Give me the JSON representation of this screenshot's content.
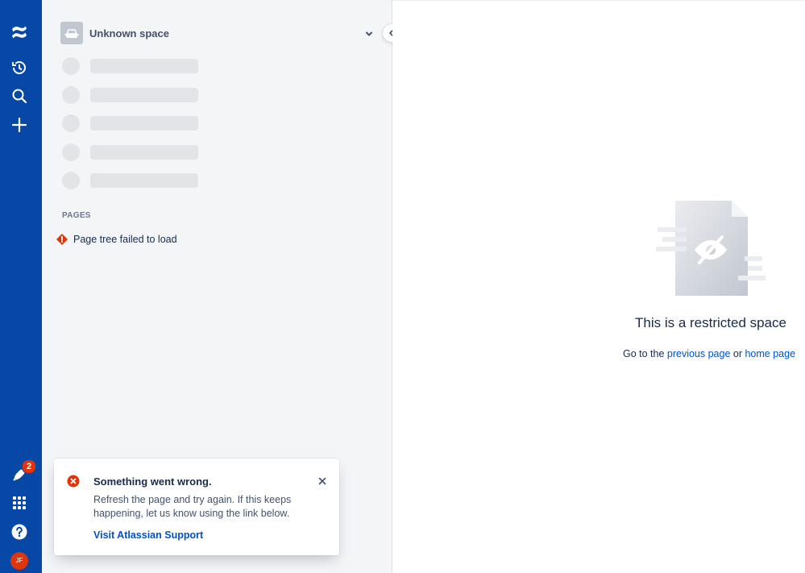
{
  "global_nav": {
    "notification_count": "2",
    "avatar_initials": "JF",
    "colors": {
      "background": "#0747A6",
      "badge": "#DE350B"
    },
    "icons": [
      "confluence-logo-icon",
      "recent-icon",
      "search-icon",
      "create-icon",
      "notifications-icon",
      "app-switcher-icon",
      "help-icon"
    ]
  },
  "sidebar": {
    "space_name": "Unknown space",
    "pages_heading": "PAGES",
    "tree_error": "Page tree failed to load",
    "skeleton_rows": 5
  },
  "main": {
    "title": "This is a restricted space",
    "sub_prefix": "Go to the ",
    "previous_link": "previous page",
    "sub_middle": " or ",
    "home_link": "home page"
  },
  "flag": {
    "title": "Something went wrong.",
    "body": "Refresh the page and try again. If this keeps happening, let us know using the link below.",
    "link": "Visit Atlassian Support",
    "colors": {
      "error": "#DE350B",
      "link": "#0052CC"
    }
  }
}
